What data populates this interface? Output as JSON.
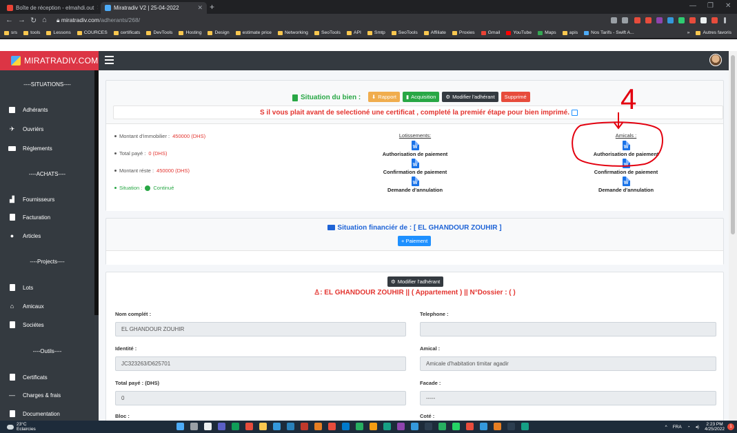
{
  "browser": {
    "tabs": [
      {
        "title": "Boîte de réception - elmahdi.out",
        "fav_color": "#ea4335"
      },
      {
        "title": "Miratradiv V2 | 25-04-2022",
        "fav_color": "#4dabf7"
      }
    ],
    "url_host": "miratradiv.com",
    "url_path": "/adherants/268/",
    "bookmarks": [
      "srs",
      "tools",
      "Lessons",
      "COURCES",
      "certificats",
      "DevTools",
      "Hosting",
      "Design",
      "estimate price",
      "Networking",
      "SeoTools",
      "API",
      "Smtp",
      "SeoTools",
      "Affiliate",
      "Proxies",
      "Gmail",
      "YouTube",
      "Maps",
      "apis",
      "Nos Tarifs - Swift A..."
    ],
    "bookmarks_more": "»",
    "other_bookmarks": "Autres favoris"
  },
  "app": {
    "brand": "MIRATRADIV.COM"
  },
  "sidebar": {
    "sections": [
      {
        "title": "----SITUATIONS----",
        "items": [
          "Adhérants",
          "Ouvriérs",
          "Réglements"
        ]
      },
      {
        "title": "----ACHATS----",
        "items": [
          "Fournisseurs",
          "Facturation",
          "Articles"
        ]
      },
      {
        "title": "----Projects----",
        "items": [
          "Lots",
          "Amicaux",
          "Sociétes"
        ]
      },
      {
        "title": "----Outils----",
        "items": [
          "Certificats",
          "Charges & frais",
          "Documentation"
        ]
      }
    ]
  },
  "situation": {
    "title": "Situation du bien :",
    "buttons": {
      "rapport": "Rapport",
      "acquisition": "Acquisition",
      "modifier": "Modifier l'adhérant",
      "supprime": "Supprimé"
    },
    "notice": "S il vous plait avant de selectioné une certificat , completé la premiér étape pour bien imprimé.",
    "info": {
      "montant_label": "Montant d'immobilier :",
      "montant_value": "450000 (DHS)",
      "paye_label": "Total payé :",
      "paye_value": "0 (DHS)",
      "reste_label": "Montant réste :",
      "reste_value": "450000 (DHS)",
      "situation_label": "Situation :",
      "situation_value": "Continué"
    },
    "lotissements": {
      "header": "Lotissements:",
      "docs": [
        "Authorisation de paiement",
        "Confirmation de paiement",
        "Demande d'annulation"
      ]
    },
    "amicals": {
      "header": "Amicals :",
      "docs": [
        "Authorisation de paiement",
        "Confirmation de paiement",
        "Demande d'annulation"
      ]
    },
    "word_icon_letter": "W"
  },
  "financial": {
    "title": "Situation financiér de : [ EL GHANDOUR ZOUHIR ]",
    "paiement_button": "+ Paiement"
  },
  "adherant": {
    "modifier_button": "Modifier l'adhérant",
    "title": ": EL GHANDOUR ZOUHIR || ( Appartement ) || N°Dossier : ( )",
    "fields": {
      "nom_label": "Nom complét :",
      "nom_value": "EL GHANDOUR ZOUHIR",
      "tel_label": "Telephone :",
      "tel_value": "",
      "identite_label": "Identité :",
      "identite_value": "JC323263/D625701",
      "amical_label": "Amical :",
      "amical_value": "Amicale d'habitation timitar agadir",
      "total_label": "Total payé : (DHS)",
      "total_value": "0",
      "facade_label": "Facade :",
      "facade_value": "-----",
      "bloc_label": "Bloc :",
      "cote_label": "Coté :"
    }
  },
  "annotation": {
    "number": "4"
  },
  "taskbar": {
    "temp": "23°C",
    "weather": "Eclaircies",
    "lang": "FRA",
    "time": "2:23 PM",
    "date": "4/25/2022",
    "notif_count": "1"
  }
}
